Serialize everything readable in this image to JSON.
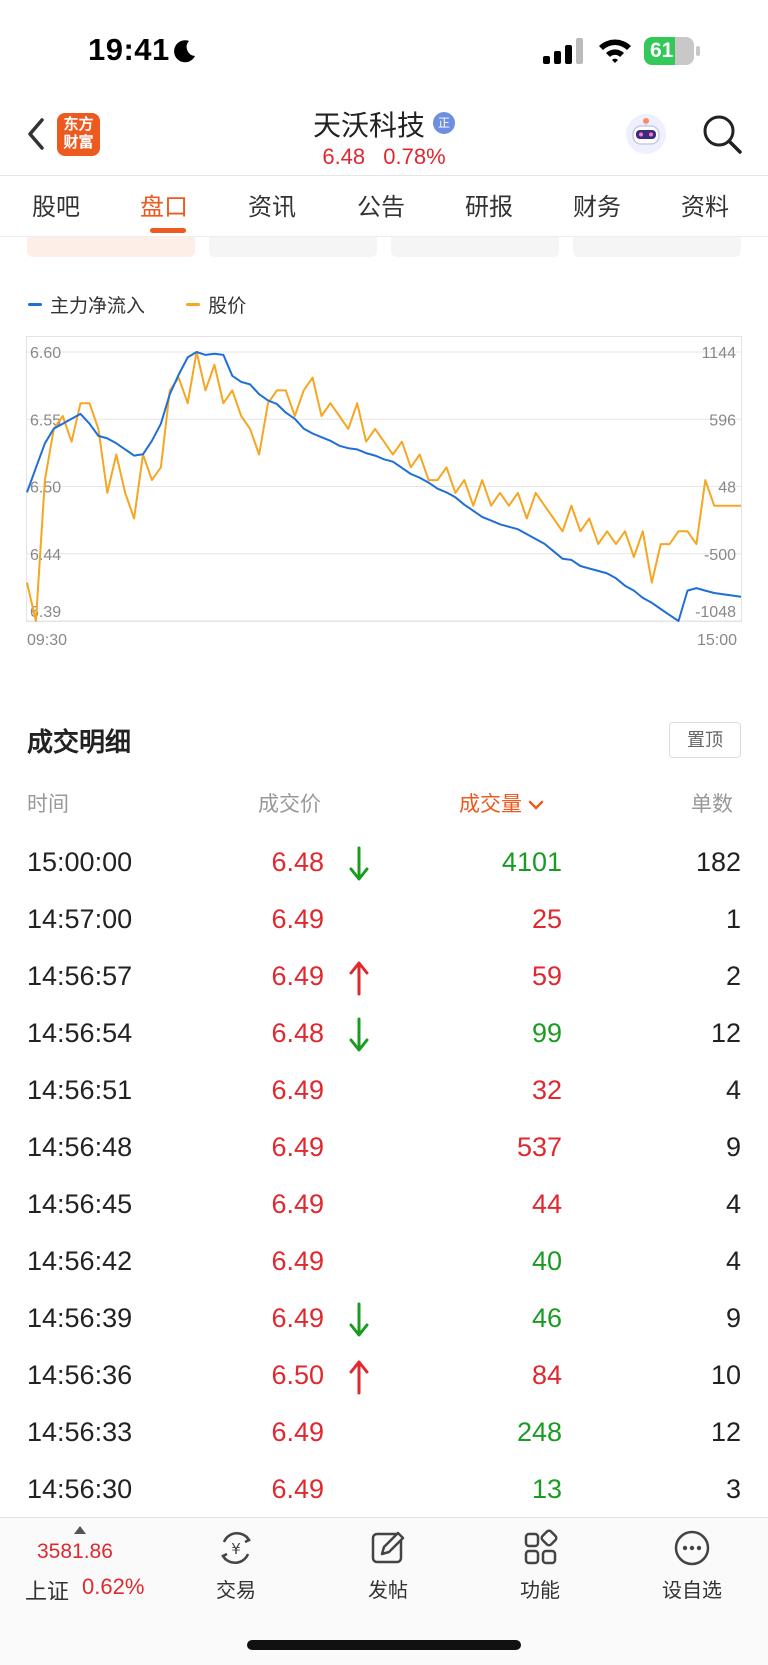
{
  "status_bar": {
    "time": "19:41",
    "battery": "61",
    "battery_level": 0.61
  },
  "header": {
    "logo_text_1": "东方",
    "logo_text_2": "财富",
    "stock_name": "天沃科技",
    "badge": "正",
    "price": "6.48",
    "change_pct": "0.78%"
  },
  "tabs": [
    "股吧",
    "盘口",
    "资讯",
    "公告",
    "研报",
    "财务",
    "资料"
  ],
  "active_tab": 1,
  "chart_data": {
    "type": "line",
    "legend": [
      "主力净流入",
      "股价"
    ],
    "colors": {
      "main_flow": "#1f6fd6",
      "price": "#f5a623"
    },
    "y_left_ticks": [
      "6.60",
      "6.55",
      "6.50",
      "6.44",
      "6.39"
    ],
    "y_right_ticks": [
      "1144",
      "596",
      "48",
      "-500",
      "-1048"
    ],
    "x_ticks": [
      "09:30",
      "15:00"
    ],
    "ylim_price": [
      6.39,
      6.6
    ],
    "ylim_flow": [
      -1048,
      1144
    ],
    "series": [
      {
        "name": "股价",
        "values": [
          6.42,
          6.39,
          6.5,
          6.54,
          6.55,
          6.53,
          6.56,
          6.56,
          6.54,
          6.49,
          6.52,
          6.49,
          6.47,
          6.52,
          6.5,
          6.51,
          6.57,
          6.58,
          6.56,
          6.6,
          6.57,
          6.59,
          6.56,
          6.57,
          6.55,
          6.54,
          6.52,
          6.56,
          6.57,
          6.57,
          6.55,
          6.57,
          6.58,
          6.55,
          6.56,
          6.55,
          6.54,
          6.56,
          6.53,
          6.54,
          6.53,
          6.52,
          6.53,
          6.51,
          6.52,
          6.5,
          6.5,
          6.51,
          6.49,
          6.5,
          6.48,
          6.5,
          6.48,
          6.49,
          6.48,
          6.49,
          6.47,
          6.49,
          6.48,
          6.47,
          6.46,
          6.48,
          6.46,
          6.47,
          6.45,
          6.46,
          6.45,
          6.46,
          6.44,
          6.46,
          6.42,
          6.45,
          6.45,
          6.46,
          6.46,
          6.45,
          6.5,
          6.48,
          6.48,
          6.48,
          6.48
        ]
      },
      {
        "name": "主力净流入",
        "values": [
          0,
          200,
          400,
          520,
          560,
          600,
          640,
          560,
          460,
          440,
          400,
          350,
          300,
          310,
          420,
          560,
          800,
          960,
          1100,
          1144,
          1120,
          1130,
          1120,
          950,
          900,
          880,
          800,
          750,
          720,
          650,
          600,
          520,
          480,
          450,
          420,
          380,
          360,
          350,
          320,
          300,
          270,
          250,
          200,
          150,
          120,
          80,
          30,
          0,
          -40,
          -100,
          -150,
          -200,
          -230,
          -260,
          -280,
          -300,
          -340,
          -380,
          -420,
          -480,
          -540,
          -550,
          -600,
          -620,
          -640,
          -660,
          -700,
          -760,
          -800,
          -860,
          -900,
          -950,
          -1000,
          -1048,
          -800,
          -780,
          -800,
          -820,
          -830,
          -840,
          -850
        ]
      }
    ]
  },
  "trade_detail": {
    "title": "成交明细",
    "pin_label": "置顶",
    "headers": {
      "time": "时间",
      "price": "成交价",
      "volume": "成交量",
      "count": "单数"
    },
    "rows": [
      {
        "time": "15:00:00",
        "price": "6.48",
        "arrow": "down",
        "volume": "4101",
        "vol_color": "green",
        "count": "182"
      },
      {
        "time": "14:57:00",
        "price": "6.49",
        "arrow": "",
        "volume": "25",
        "vol_color": "red",
        "count": "1"
      },
      {
        "time": "14:56:57",
        "price": "6.49",
        "arrow": "up",
        "volume": "59",
        "vol_color": "red",
        "count": "2"
      },
      {
        "time": "14:56:54",
        "price": "6.48",
        "arrow": "down",
        "volume": "99",
        "vol_color": "green",
        "count": "12"
      },
      {
        "time": "14:56:51",
        "price": "6.49",
        "arrow": "",
        "volume": "32",
        "vol_color": "red",
        "count": "4"
      },
      {
        "time": "14:56:48",
        "price": "6.49",
        "arrow": "",
        "volume": "537",
        "vol_color": "red",
        "count": "9"
      },
      {
        "time": "14:56:45",
        "price": "6.49",
        "arrow": "",
        "volume": "44",
        "vol_color": "red",
        "count": "4"
      },
      {
        "time": "14:56:42",
        "price": "6.49",
        "arrow": "",
        "volume": "40",
        "vol_color": "green",
        "count": "4"
      },
      {
        "time": "14:56:39",
        "price": "6.49",
        "arrow": "down",
        "volume": "46",
        "vol_color": "green",
        "count": "9"
      },
      {
        "time": "14:56:36",
        "price": "6.50",
        "arrow": "up",
        "volume": "84",
        "vol_color": "red",
        "count": "10"
      },
      {
        "time": "14:56:33",
        "price": "6.49",
        "arrow": "",
        "volume": "248",
        "vol_color": "green",
        "count": "12"
      },
      {
        "time": "14:56:30",
        "price": "6.49",
        "arrow": "",
        "volume": "13",
        "vol_color": "green",
        "count": "3"
      }
    ]
  },
  "bottom_bar": {
    "index_value": "3581.86",
    "index_name": "上证",
    "index_pct": "0.62%",
    "nav": [
      {
        "label": "交易",
        "icon": "trade-icon"
      },
      {
        "label": "发帖",
        "icon": "compose-icon"
      },
      {
        "label": "功能",
        "icon": "apps-icon"
      },
      {
        "label": "设自选",
        "icon": "more-icon"
      }
    ]
  }
}
